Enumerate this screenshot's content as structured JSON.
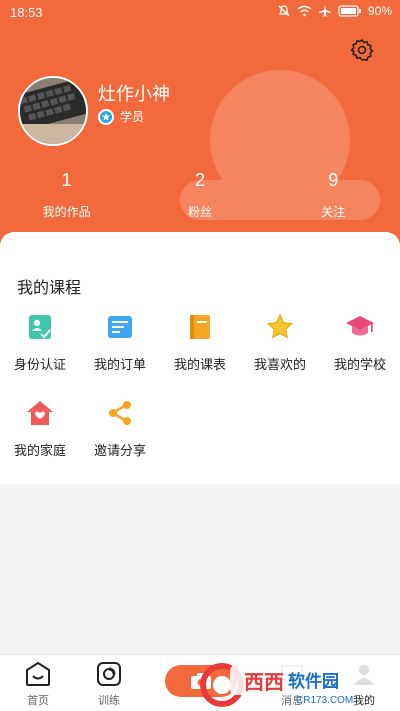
{
  "status_bar": {
    "time": "18:53",
    "battery": "90%"
  },
  "profile": {
    "username": "灶作小神",
    "role": "学员"
  },
  "stats": [
    {
      "value": "1",
      "label": "我的作品"
    },
    {
      "value": "2",
      "label": "粉丝"
    },
    {
      "value": "9",
      "label": "关注"
    }
  ],
  "section": {
    "title": "我的课程"
  },
  "menu": [
    {
      "label": "身份认证",
      "icon": "id-card-icon"
    },
    {
      "label": "我的订单",
      "icon": "order-icon"
    },
    {
      "label": "我的课表",
      "icon": "book-icon"
    },
    {
      "label": "我喜欢的",
      "icon": "star-icon"
    },
    {
      "label": "我的学校",
      "icon": "graduation-cap-icon"
    },
    {
      "label": "我的家庭",
      "icon": "home-icon"
    },
    {
      "label": "邀请分享",
      "icon": "share-icon"
    }
  ],
  "tabbar": {
    "home": "首页",
    "training": "训练",
    "messages": "消息",
    "mine": "我的"
  },
  "watermark": {
    "brand": "西西软件园",
    "domain": "CR173.COM"
  },
  "colors": {
    "accent": "#f26a3b"
  }
}
